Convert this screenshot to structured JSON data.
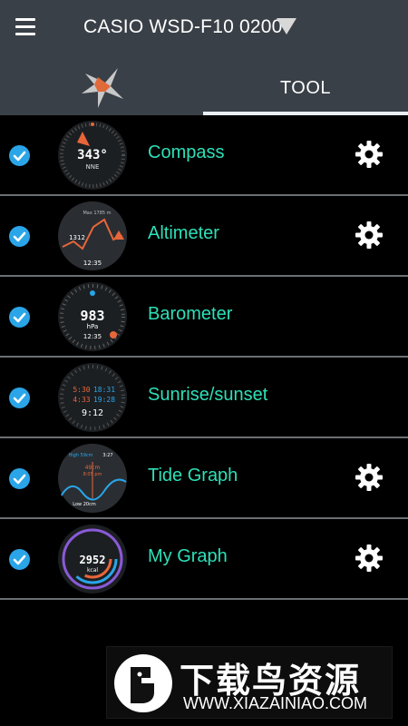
{
  "header": {
    "device_name": "CASIO WSD-F10 0200",
    "menu_icon": "hamburger-menu-icon",
    "dropdown_icon": "dropdown-triangle-icon"
  },
  "tabs": {
    "logo_icon": "app-logo-icon",
    "tool_label": "TOOL"
  },
  "colors": {
    "bar_bg": "#3a4047",
    "accent_label": "#2de0b8",
    "check_blue": "#2aa5e8"
  },
  "tools": [
    {
      "label": "Compass",
      "checked": true,
      "has_settings": true,
      "face": {
        "line1": "343°",
        "line2": "NNE"
      }
    },
    {
      "label": "Altimeter",
      "checked": true,
      "has_settings": true,
      "face": {
        "line1": "1312",
        "line2": "12:35",
        "top": "Max 1785 m"
      }
    },
    {
      "label": "Barometer",
      "checked": true,
      "has_settings": false,
      "face": {
        "line1": "983",
        "line2": "hPa",
        "line3": "12:35"
      }
    },
    {
      "label": "Sunrise/sunset",
      "checked": true,
      "has_settings": false,
      "face": {
        "a": "5:30",
        "b": "18:31",
        "c": "4:33",
        "d": "19:28",
        "e": "9:12"
      }
    },
    {
      "label": "Tide Graph",
      "checked": true,
      "has_settings": true,
      "face": {
        "top": "High 59cm",
        "topr": "3:27",
        "mid": "49cm",
        "mid2": "8:05 pm",
        "low": "Low 20cm"
      }
    },
    {
      "label": "My Graph",
      "checked": true,
      "has_settings": true,
      "face": {
        "line1": "2952",
        "line2": "kcal"
      }
    }
  ],
  "watermark": {
    "brand_cn": "下载鸟资源",
    "url": "WWW.XIAZAINIAO.COM"
  }
}
